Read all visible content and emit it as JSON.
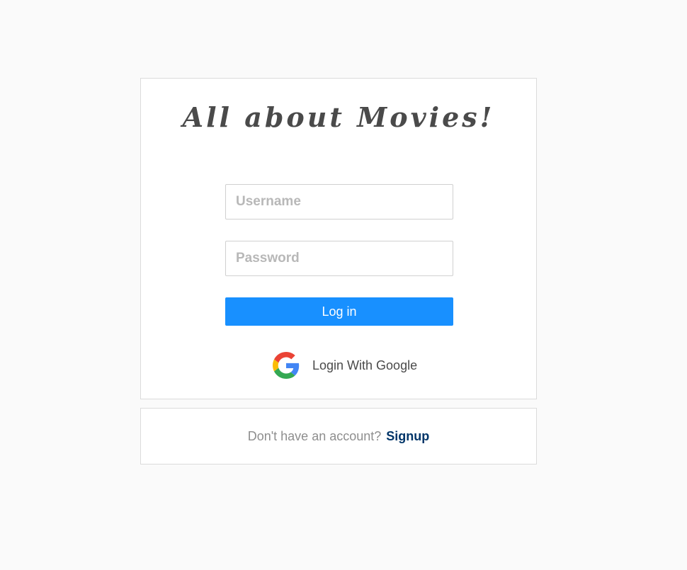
{
  "brand": {
    "title": "All about Movies!"
  },
  "login_form": {
    "username_placeholder": "Username",
    "username_value": "",
    "password_placeholder": "Password",
    "password_value": "",
    "login_label": "Log in",
    "google_label": "Login With Google",
    "google_icon": "google-icon"
  },
  "signup": {
    "prompt": "Don't have an account?",
    "link_label": "Signup"
  },
  "colors": {
    "background": "#fafafa",
    "card_border": "#dbdbdb",
    "primary_button": "#1890ff",
    "signup_link": "#003569",
    "title_text": "#4a4a4a"
  }
}
